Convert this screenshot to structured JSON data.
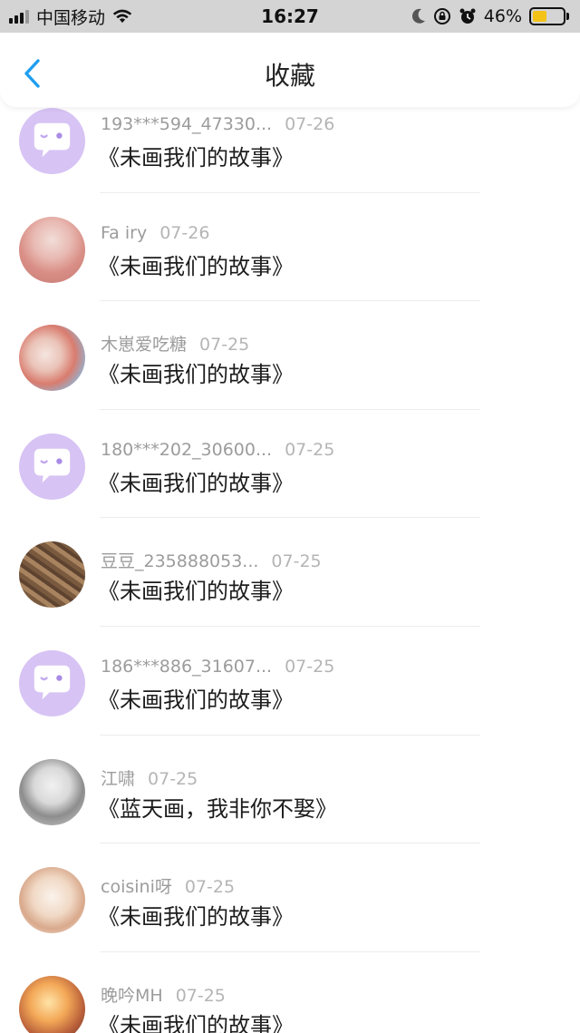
{
  "status_bar": {
    "carrier": "中国移动",
    "time": "16:27",
    "battery_percent": "46%",
    "battery_level": 0.46,
    "battery_color": "#f4c318"
  },
  "nav": {
    "title": "收藏",
    "back_icon": "chevron-left-icon",
    "accent": "#1e9ef0"
  },
  "items": [
    {
      "user": "193***594_47330...",
      "date": "07-26",
      "title": "《未画我们的故事》",
      "avatar": "default"
    },
    {
      "user": "Fa iry",
      "date": "07-26",
      "title": "《未画我们的故事》",
      "avatar": "photo"
    },
    {
      "user": "木崽爱吃糖",
      "date": "07-25",
      "title": "《未画我们的故事》",
      "avatar": "photo"
    },
    {
      "user": "180***202_30600...",
      "date": "07-25",
      "title": "《未画我们的故事》",
      "avatar": "default"
    },
    {
      "user": "豆豆_235888053...",
      "date": "07-25",
      "title": "《未画我们的故事》",
      "avatar": "photo"
    },
    {
      "user": "186***886_31607...",
      "date": "07-25",
      "title": "《未画我们的故事》",
      "avatar": "default"
    },
    {
      "user": "江啸",
      "date": "07-25",
      "title": "《蓝天画，我非你不娶》",
      "avatar": "photo"
    },
    {
      "user": "coisini呀",
      "date": "07-25",
      "title": "《未画我们的故事》",
      "avatar": "photo"
    },
    {
      "user": "晚吟MH",
      "date": "07-25",
      "title": "《未画我们的故事》",
      "avatar": "photo"
    }
  ]
}
